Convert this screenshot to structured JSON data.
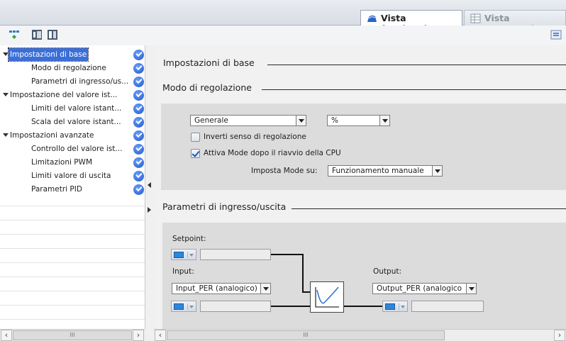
{
  "tabs": {
    "functional": "Vista funzionale",
    "parameters": "Vista parametri"
  },
  "nav": {
    "items": [
      {
        "label": "Impostazioni di base",
        "expanded": true,
        "selected": true,
        "level": 0
      },
      {
        "label": "Modo di regolazione",
        "level": 1
      },
      {
        "label": "Parametri di ingresso/us...",
        "level": 1
      },
      {
        "label": "Impostazione del valore ist...",
        "expanded": true,
        "level": 0
      },
      {
        "label": "Limiti del valore istant...",
        "level": 1
      },
      {
        "label": "Scala del valore istant...",
        "level": 1
      },
      {
        "label": "Impostazioni avanzate",
        "expanded": true,
        "level": 0
      },
      {
        "label": "Controllo del valore ist...",
        "level": 1
      },
      {
        "label": "Limitazioni PWM",
        "level": 1
      },
      {
        "label": "Limiti valore di uscita",
        "level": 1
      },
      {
        "label": "Parametri PID",
        "level": 1
      }
    ]
  },
  "content": {
    "basic_settings_title": "Impostazioni di base",
    "control_mode_title": "Modo di regolazione",
    "controller_type": "Generale",
    "unit": "%",
    "invert_label": "Inverti senso di regolazione",
    "invert_checked": false,
    "activate_label": "Attiva Mode dopo il riavvio della CPU",
    "activate_checked": true,
    "set_mode_label": "Imposta Mode su:",
    "set_mode_value": "Funzionamento manuale",
    "io_title": "Parametri di ingresso/uscita",
    "setpoint_label": "Setpoint:",
    "input_label": "Input:",
    "input_value": "Input_PER (analogico)",
    "output_label": "Output:",
    "output_value": "Output_PER (analogico"
  },
  "colors": {
    "accent": "#3b6fd8",
    "check": "#2055c8",
    "io_block": "#2e86d8"
  },
  "icons": [
    "functional-view-icon",
    "parameter-view-icon",
    "view-network-icon",
    "expand-all-icon",
    "collapse-all-icon",
    "panel-toggle-icon",
    "check-icon",
    "controller-icon"
  ],
  "scroll": {
    "left": "‹",
    "right": "›",
    "grip": "III"
  }
}
